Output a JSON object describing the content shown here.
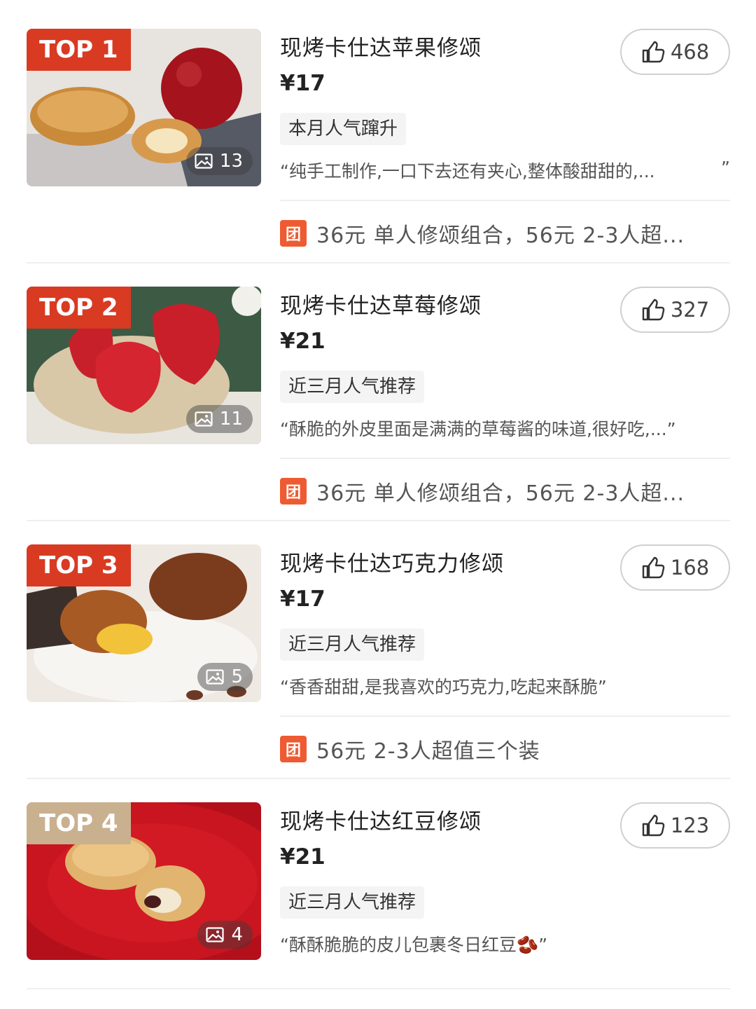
{
  "items": [
    {
      "rank": "TOP 1",
      "title": "现烤卡仕达苹果修颂",
      "price": "¥17",
      "tag": "本月人气蹿升",
      "review": "“纯手工制作,一口下去还有夹心,整体酸甜甜的,...",
      "review_end": "”",
      "likes": "468",
      "image_count": "13",
      "deal": "36元 单人修颂组合，56元 2-3人超...",
      "deal_icon": "团",
      "badge_color": "#d93a22"
    },
    {
      "rank": "TOP 2",
      "title": "现烤卡仕达草莓修颂",
      "price": "¥21",
      "tag": "近三月人气推荐",
      "review": "“酥脆的外皮里面是满满的草莓酱的味道,很好吃,...”",
      "review_end": "",
      "likes": "327",
      "image_count": "11",
      "deal": "36元 单人修颂组合，56元 2-3人超...",
      "deal_icon": "团",
      "badge_color": "#d93a22"
    },
    {
      "rank": "TOP 3",
      "title": "现烤卡仕达巧克力修颂",
      "price": "¥17",
      "tag": "近三月人气推荐",
      "review": "“香香甜甜,是我喜欢的巧克力,吃起来酥脆”",
      "review_end": "",
      "likes": "168",
      "image_count": "5",
      "deal": "56元 2-3人超值三个装",
      "deal_icon": "团",
      "badge_color": "#d93a22"
    },
    {
      "rank": "TOP 4",
      "title": "现烤卡仕达红豆修颂",
      "price": "¥21",
      "tag": "近三月人气推荐",
      "review": "“酥酥脆脆的皮儿包裹冬日红豆🫘”",
      "review_end": "",
      "likes": "123",
      "image_count": "4",
      "badge_color": "#c9b08f"
    }
  ],
  "colors": {
    "accent": "#d93a22",
    "deal_icon_bg": "#ee5b32",
    "muted_badge": "#c9b08f"
  }
}
